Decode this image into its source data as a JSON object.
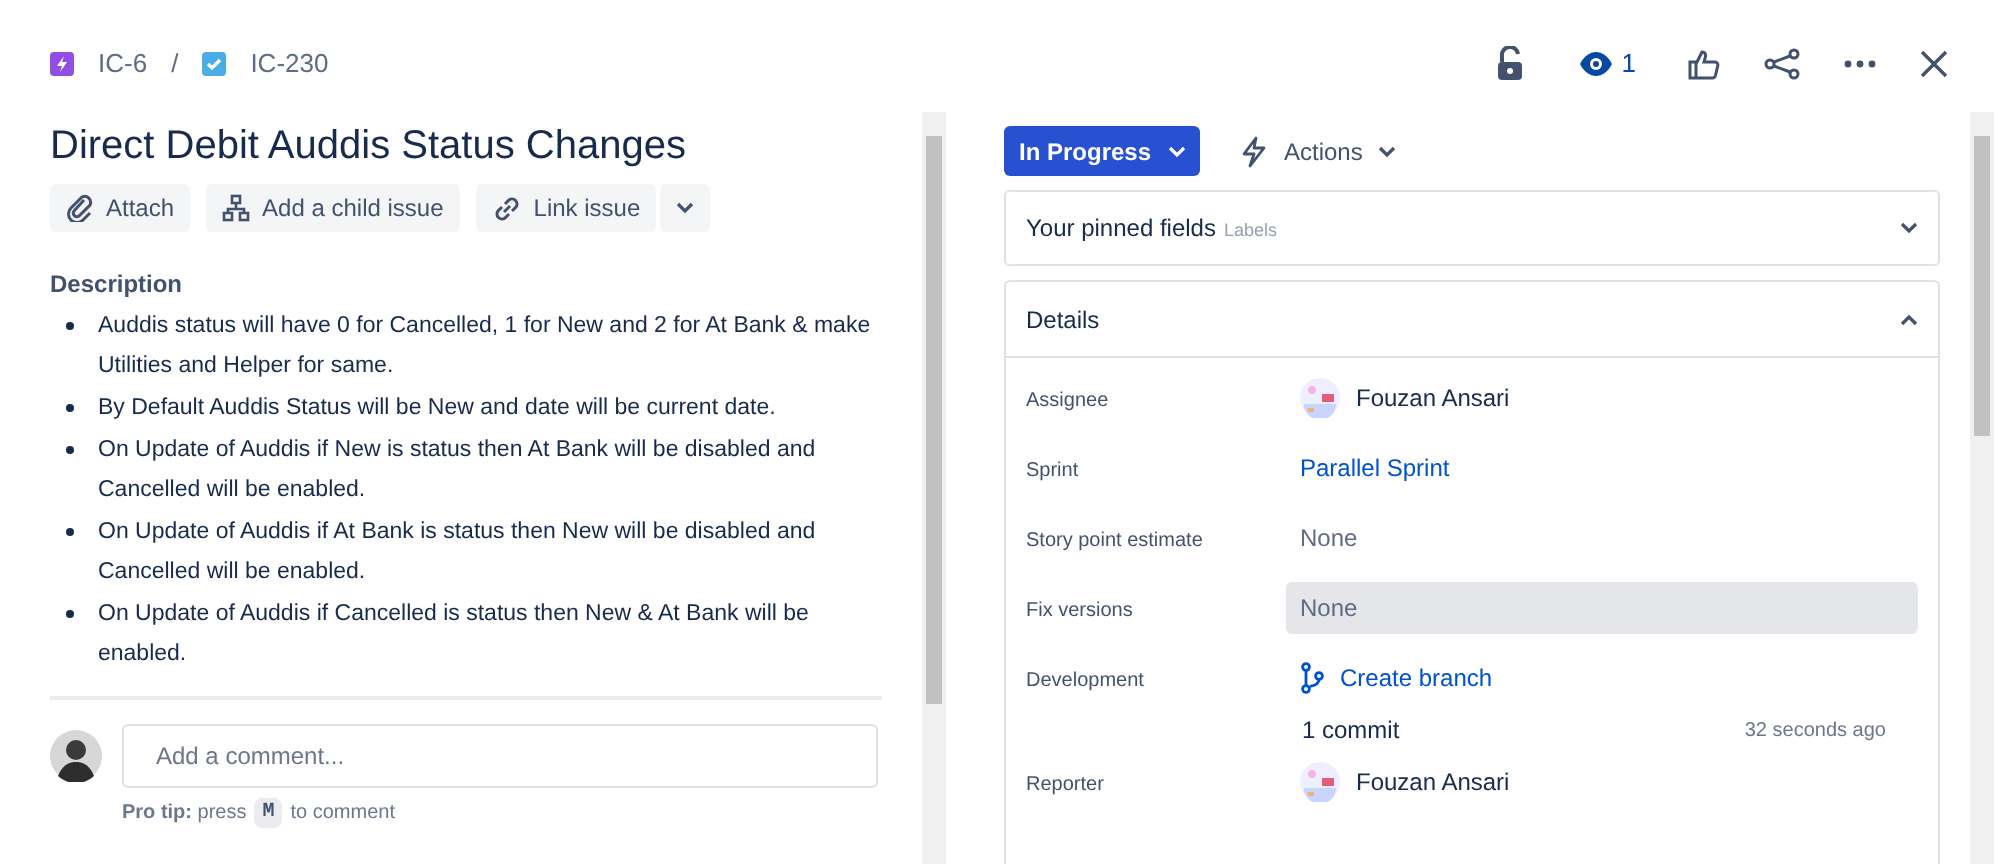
{
  "breadcrumbs": [
    {
      "label": "IC-6",
      "kind": "epic"
    },
    {
      "label": "IC-230",
      "kind": "task"
    }
  ],
  "separator": "/",
  "watchers": "1",
  "title": "Direct Debit Auddis Status Changes",
  "toolbar": [
    {
      "label": "Attach",
      "kind": "attach"
    },
    {
      "label": "Add a child issue",
      "kind": "child"
    },
    {
      "label": "Link issue",
      "kind": "link"
    }
  ],
  "description": {
    "heading": "Description",
    "items": [
      "Auddis status will have 0 for Cancelled, 1 for New and 2 for At Bank & make Utilities and Helper for same.",
      "By Default Auddis Status will be New and date will be current date.",
      "On Update of Auddis if New is status then At Bank will be disabled and Cancelled will be enabled.",
      "On Update of Auddis if At Bank is status then New will be disabled and Cancelled will be enabled.",
      "On Update of Auddis if Cancelled is status then New & At Bank will be enabled."
    ]
  },
  "comment": {
    "placeholder": "Add a comment...",
    "tip": "**Pro tip:** press",
    "key": "M",
    "tip_end": "to comment"
  },
  "status": "In Progress",
  "actions": "Actions",
  "pinned": {
    "title": "Your pinned fields",
    "hint": "Labels",
    "expanded": false
  },
  "details": {
    "title": "Details",
    "expanded": true,
    "fields": [
      {
        "label": "Assignee",
        "kind": "user",
        "value": "Fouzan Ansari"
      },
      {
        "label": "Sprint",
        "kind": "link",
        "value": "Parallel Sprint"
      },
      {
        "label": "Story point estimate",
        "kind": "text",
        "value": "None",
        "hovered": false
      },
      {
        "label": "Fix versions",
        "kind": "text",
        "value": "None",
        "hovered": true
      },
      {
        "label": "Development",
        "kind": "dev",
        "value": "Create branch",
        "commits": "1 commit",
        "time": "32 seconds ago"
      },
      {
        "label": "Reporter",
        "kind": "user",
        "value": "Fouzan Ansari"
      }
    ]
  }
}
